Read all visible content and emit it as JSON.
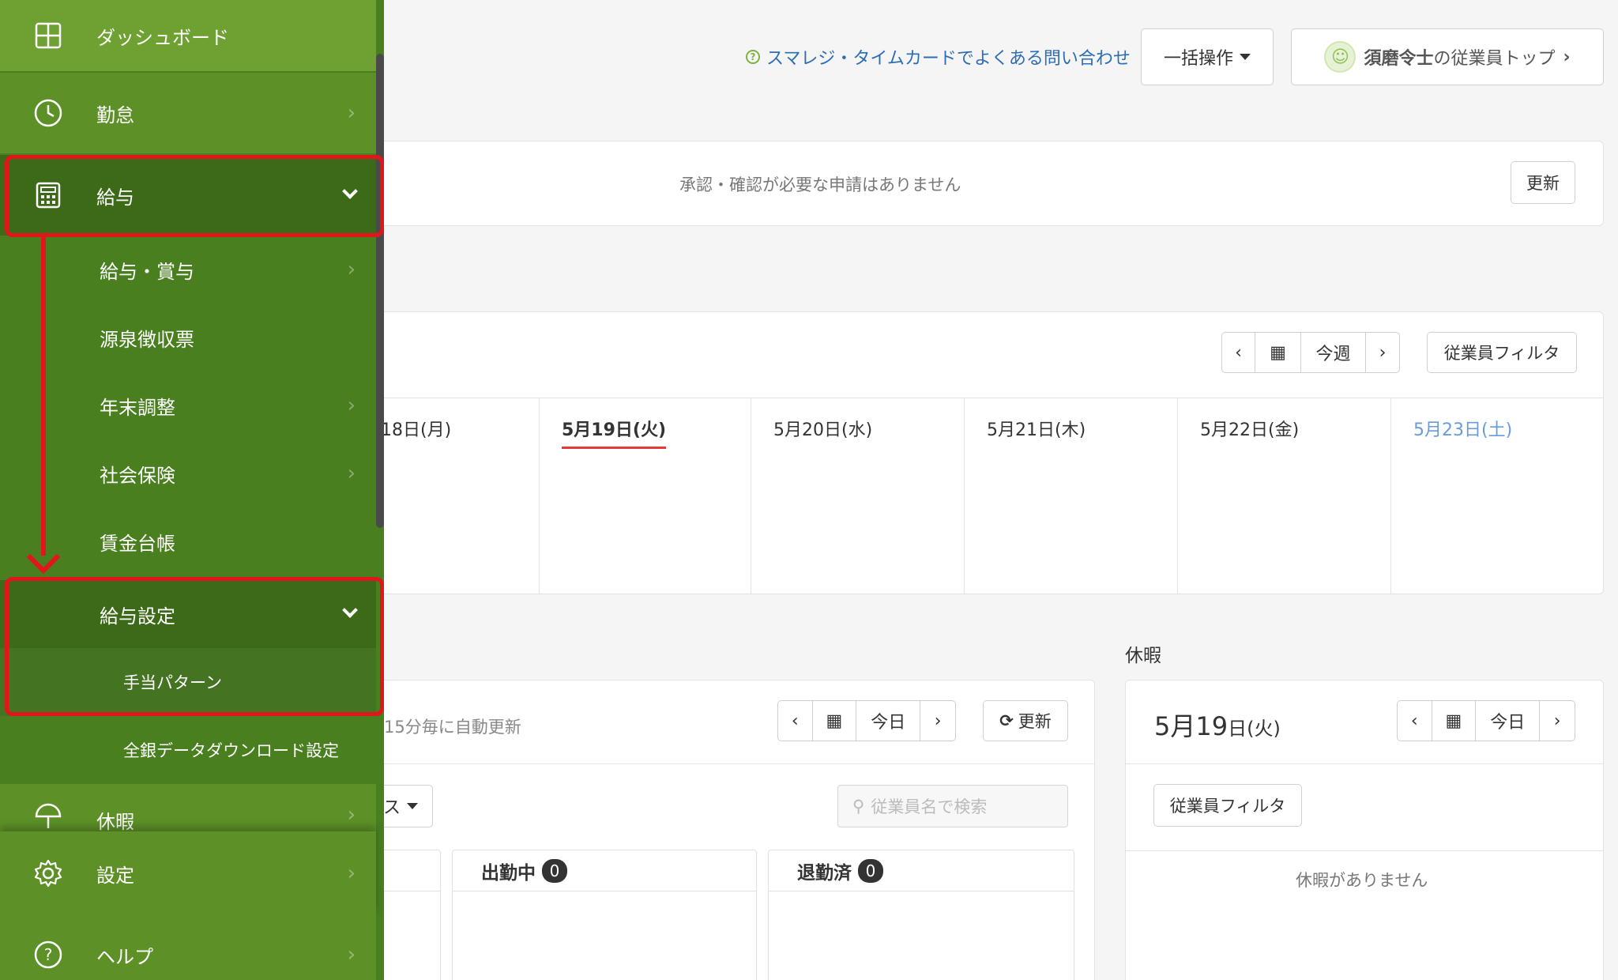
{
  "header": {
    "help_link": "スマレジ・タイムカードでよくある問い合わせ",
    "bulk_button": "一括操作",
    "employee_name": "須磨令士",
    "employee_top_suffix": "の従業員トップ"
  },
  "approval": {
    "message": "承認・確認が必要な申請はありません",
    "refresh": "更新"
  },
  "week": {
    "nav_label": "今週",
    "filter": "従業員フィルタ",
    "days": [
      {
        "label": "18日(月)"
      },
      {
        "label": "5月19日(火)"
      },
      {
        "label": "5月20日(水)"
      },
      {
        "label": "5月21日(木)"
      },
      {
        "label": "5月22日(金)"
      },
      {
        "label": "5月23日(土)"
      }
    ]
  },
  "attendance": {
    "auto_refresh": "15分毎に自動更新",
    "nav_label": "今日",
    "refresh": "更新",
    "status_dropdown_tail": "ス",
    "search_placeholder": "従業員名で検索",
    "columns": [
      {
        "label": "出勤中",
        "count": "0"
      },
      {
        "label": "退勤済",
        "count": "0"
      }
    ]
  },
  "vacation": {
    "title": "休暇",
    "date_month_day": "5月19",
    "date_suffix": "日(火)",
    "nav_label": "今日",
    "filter": "従業員フィルタ",
    "empty": "休暇がありません"
  },
  "sidebar": {
    "dashboard": "ダッシュボード",
    "kintai": "勤怠",
    "kyuyo": "給与",
    "sub": {
      "kyuyo_shoyo": "給与・賞与",
      "gensen": "源泉徴収票",
      "nenmatsu": "年末調整",
      "shakai": "社会保険",
      "chingin": "賃金台帳",
      "kyuyo_settei": "給与設定",
      "teate": "手当パターン",
      "zengin": "全銀データダウンロード設定"
    },
    "kyuka": "休暇",
    "settei": "設定",
    "help": "ヘルプ"
  },
  "colors": {
    "sidebar_bg": "#4a7f1f",
    "sidebar_active": "#6fa032",
    "highlight": "#e0161b",
    "link": "#2d6db5"
  }
}
